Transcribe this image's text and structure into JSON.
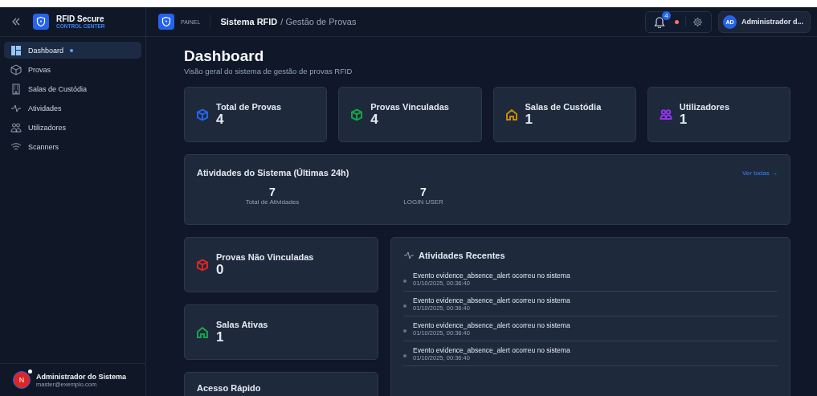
{
  "sidebar": {
    "brand": {
      "title": "RFID Secure",
      "subtitle": "CONTROL CENTER"
    },
    "items": [
      {
        "label": "Dashboard",
        "kind": "dashboard",
        "selected": true
      },
      {
        "label": "Provas",
        "kind": "box",
        "selected": false
      },
      {
        "label": "Salas de Custódia",
        "kind": "building",
        "selected": false
      },
      {
        "label": "Atividades",
        "kind": "activity",
        "selected": false
      },
      {
        "label": "Utilizadores",
        "kind": "users",
        "selected": false
      },
      {
        "label": "Scanners",
        "kind": "wifi",
        "selected": false
      }
    ],
    "user": {
      "initial": "N",
      "name": "Administrador do Sistema",
      "email": "master@exemplo.com"
    }
  },
  "header": {
    "badge": "PAINEL",
    "title": "Sistema RFID",
    "breadcrumb": "/ Gestão de Provas",
    "notifications": "4",
    "user": {
      "initials": "AD",
      "name": "Administrador d..."
    }
  },
  "page": {
    "title": "Dashboard",
    "subtitle": "Visão geral do sistema de gestão de provas RFID"
  },
  "stats": [
    {
      "label": "Total de Provas",
      "value": "4",
      "kind": "box",
      "color": "#2563eb"
    },
    {
      "label": "Provas Vinculadas",
      "value": "4",
      "kind": "box",
      "color": "#16a34a"
    },
    {
      "label": "Salas de Custódia",
      "value": "1",
      "kind": "home",
      "color": "#ca8a04"
    },
    {
      "label": "Utilizadores",
      "value": "1",
      "kind": "users",
      "color": "#9333ea"
    }
  ],
  "activity_summary": {
    "title": "Atividades do Sistema (Últimas 24h)",
    "link": "Ver todas →",
    "metrics": [
      {
        "value": "7",
        "label": "Total de Atividades"
      },
      {
        "value": "7",
        "label": "LOGIN USER"
      }
    ]
  },
  "side_cards": [
    {
      "label": "Provas Não Vinculadas",
      "value": "0",
      "kind": "box",
      "color": "#dc2626"
    },
    {
      "label": "Salas Ativas",
      "value": "1",
      "kind": "home",
      "color": "#16a34a"
    }
  ],
  "quick_access": {
    "title": "Acesso Rápido"
  },
  "recent": {
    "title": "Atividades Recentes",
    "items": [
      {
        "text": "Evento evidence_absence_alert ocorreu no sistema",
        "time": "01/10/2025, 00:36:40"
      },
      {
        "text": "Evento evidence_absence_alert ocorreu no sistema",
        "time": "01/10/2025, 00:36:40"
      },
      {
        "text": "Evento evidence_absence_alert ocorreu no sistema",
        "time": "01/10/2025, 00:36:40"
      },
      {
        "text": "Evento evidence_absence_alert ocorreu no sistema",
        "time": "01/10/2025, 00:36:40"
      }
    ]
  }
}
